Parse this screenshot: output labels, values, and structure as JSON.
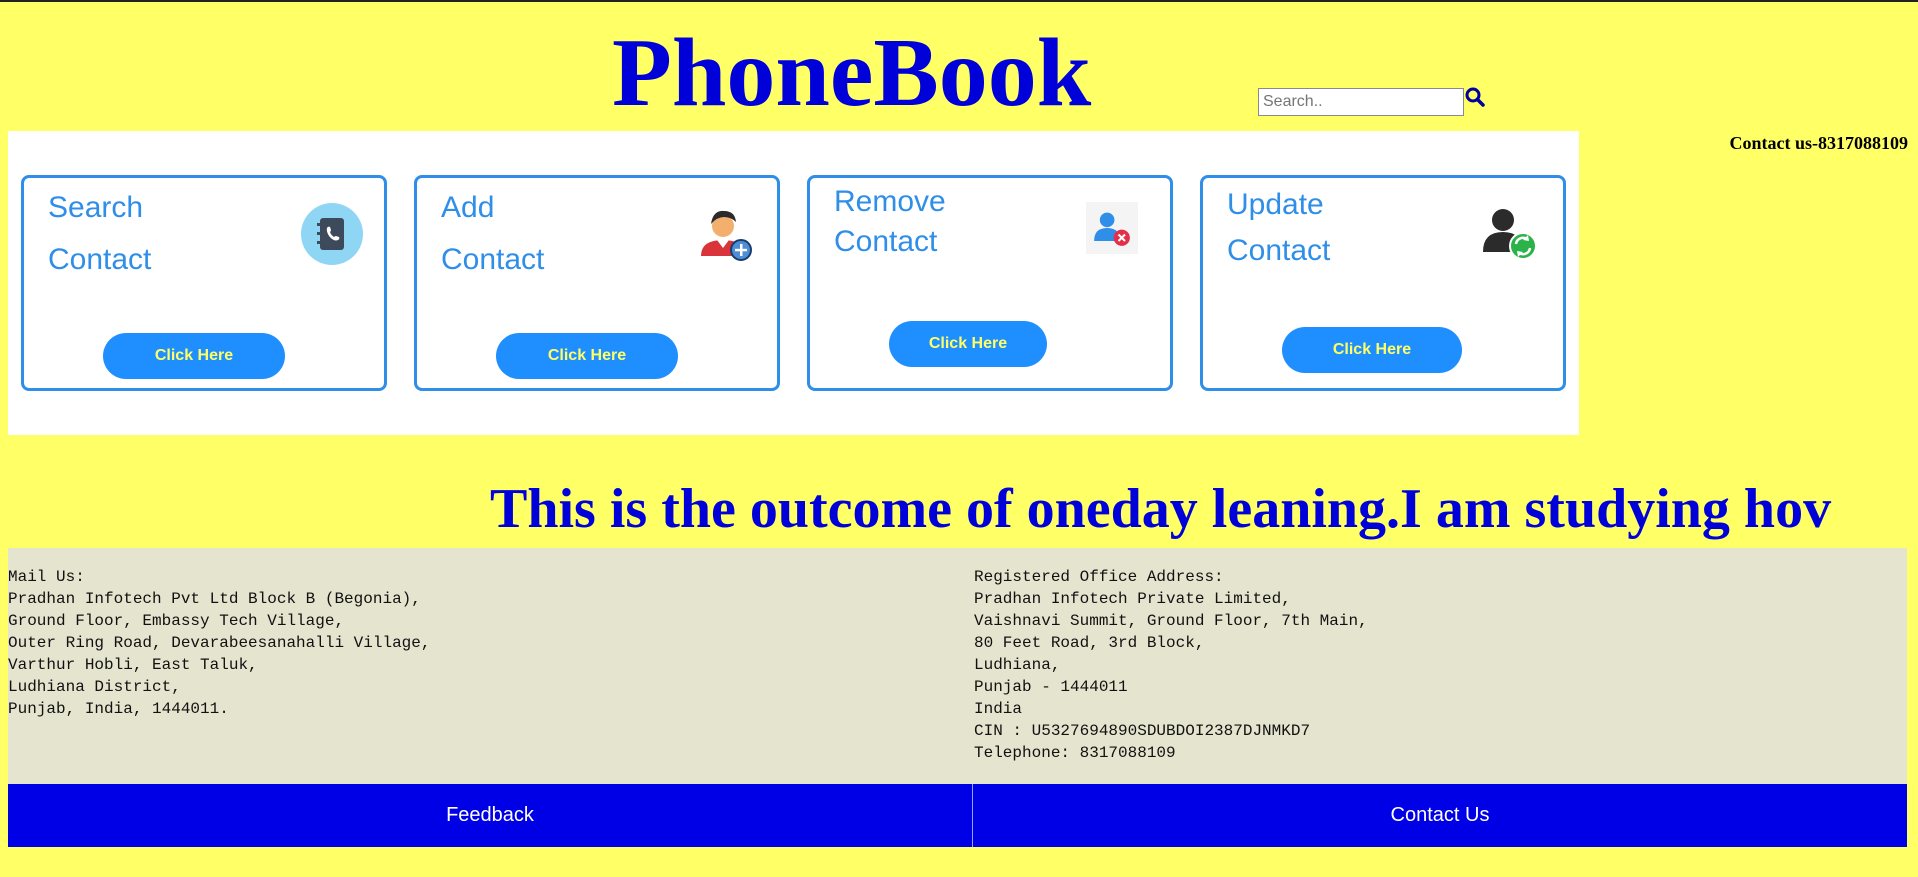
{
  "header": {
    "title": "PhoneBook",
    "search_placeholder": "Search..",
    "contact_line": "Contact us-8317088109"
  },
  "cards": [
    {
      "title_line1": "Search",
      "title_line2": "Contact",
      "icon": "phonebook-icon",
      "button_label": "Click Here"
    },
    {
      "title_line1": "Add",
      "title_line2": "Contact",
      "icon": "add-user-icon",
      "button_label": "Click Here"
    },
    {
      "title_line1": "Remove",
      "title_line2": "Contact",
      "icon": "remove-user-icon",
      "button_label": "Click Here"
    },
    {
      "title_line1": "Update",
      "title_line2": "Contact",
      "icon": "update-user-icon",
      "button_label": "Click Here"
    }
  ],
  "marquee_text": "This is the outcome of oneday leaning.I am studying hov",
  "address": {
    "mail": "Mail Us:\nPradhan Infotech Pvt Ltd Block B (Begonia),\nGround Floor, Embassy Tech Village,\nOuter Ring Road, Devarabeesanahalli Village,\nVarthur Hobli, East Taluk,\nLudhiana District,\nPunjab, India, 1444011.",
    "registered": "Registered Office Address:\nPradhan Infotech Private Limited,\nVaishnavi Summit, Ground Floor, 7th Main,\n80 Feet Road, 3rd Block,\nLudhiana,\nPunjab - 1444011\nIndia\nCIN : U5327694890SDUBDOI2387DJNMKD7\nTelephone: 8317088109"
  },
  "footer": {
    "feedback_label": "Feedback",
    "contact_label": "Contact Us"
  },
  "colors": {
    "page_bg": "#ffff66",
    "title_blue": "#0000d9",
    "card_accent": "#2f8ee8",
    "button_bg": "#1f8fff",
    "footer_bg": "#0000e6",
    "address_bg": "#e5e4cf"
  }
}
